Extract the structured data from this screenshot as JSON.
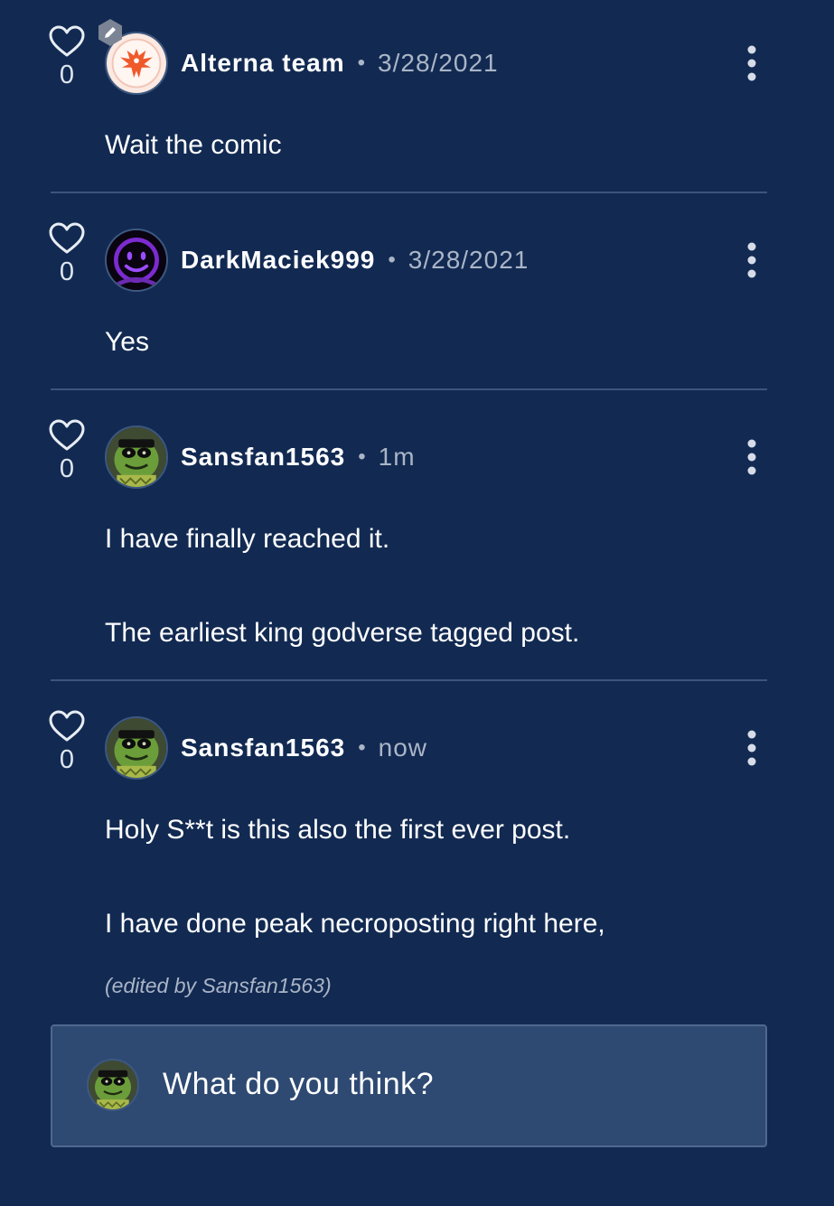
{
  "comments": [
    {
      "likes": "0",
      "username": "Alterna team",
      "separator": "•",
      "time": "3/28/2021",
      "body": [
        "Wait the comic"
      ],
      "avatar_icon": "phoenix-logo-avatar",
      "has_mod_badge": true
    },
    {
      "likes": "0",
      "username": "DarkMaciek999",
      "separator": "•",
      "time": "3/28/2021",
      "body": [
        "Yes"
      ],
      "avatar_icon": "purple-smiley-avatar"
    },
    {
      "likes": "0",
      "username": "Sansfan1563",
      "separator": "•",
      "time": "1m",
      "body": [
        "I have finally reached it.",
        "The earliest king godverse tagged post."
      ],
      "avatar_icon": "green-character-avatar"
    },
    {
      "likes": "0",
      "username": "Sansfan1563",
      "separator": "•",
      "time": "now",
      "body": [
        "Holy S**t is this also the first ever post.",
        "I have done peak necroposting right here,"
      ],
      "edited": "(edited by Sansfan1563)",
      "avatar_icon": "green-character-avatar"
    }
  ],
  "reply": {
    "placeholder": "What do you think?",
    "avatar_icon": "green-character-avatar"
  },
  "colors": {
    "background": "#122a52",
    "reply_box": "#2e4a72",
    "muted_text": "#aab5c6",
    "divider": "#3d557a"
  }
}
